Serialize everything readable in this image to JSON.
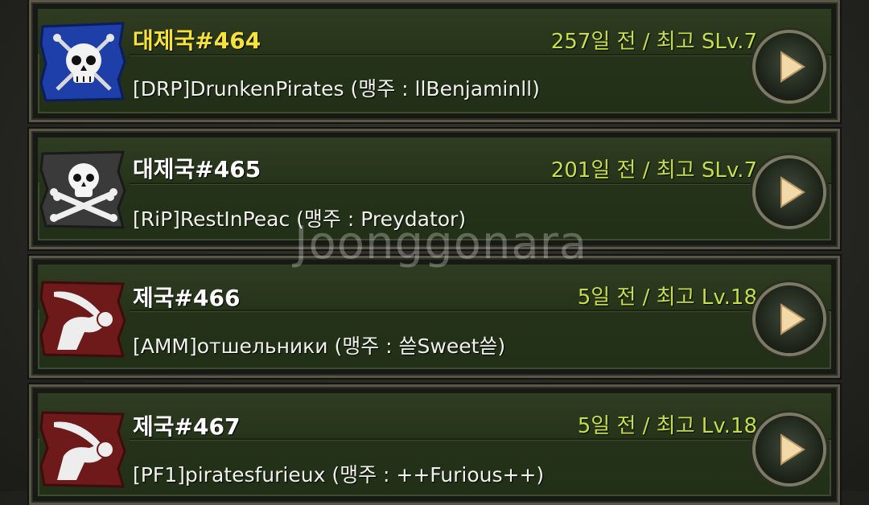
{
  "rows": [
    {
      "kingdom": "대제국#464",
      "info": "257일 전 / 최고 SLv.7",
      "alliance": "[DRP]DrunkenPirates (맹주 : llBenjaminll)",
      "flag": "blue-skull-swords-flag",
      "highlight_color": "#f7e23a"
    },
    {
      "kingdom": "대제국#465",
      "info": "201일 전 / 최고 SLv.7",
      "alliance": "[RiP]RestInPeac (맹주 : Preydator)",
      "flag": "black-skull-crossbones-flag"
    },
    {
      "kingdom": "제국#466",
      "info": "5일 전 / 최고 Lv.18",
      "alliance": "[AMM]отшельники (맹주 : 쓷Sweet쓷)",
      "flag": "red-arm-sabre-flag"
    },
    {
      "kingdom": "제국#467",
      "info": "5일 전 / 최고 Lv.18",
      "alliance": "[PF1]piratesfurieux (맹주 : ++Furious++)",
      "flag": "red-arm-sabre-flag"
    }
  ],
  "watermark": "Joonggonara"
}
